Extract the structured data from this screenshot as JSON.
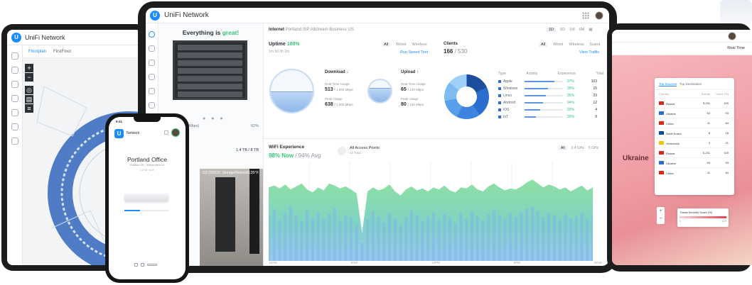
{
  "main": {
    "brand": "UniFi Network",
    "device_panel": {
      "status_prefix": "Everything is ",
      "status_word": "great!",
      "ports_label": "Ports (Fast 24 Mbps)",
      "ports_pct": "62%",
      "storage": "1.4 TB / 8 TB",
      "camera_label": "G3 2/25/20, Storage/Network",
      "camera_temp": "135°F"
    },
    "internet": {
      "label": "Internet",
      "isp": "Portland ISP Allstream Business US",
      "ranges": [
        "1D",
        "5D",
        "1M",
        "6M"
      ],
      "uptime_label": "Uptime",
      "uptime_value": "100%",
      "uptime_sub": "1m 5d 3h 2m",
      "filters": [
        "All",
        "Wired",
        "Wireless"
      ],
      "speed_test": "Run Speed Test",
      "download": {
        "title": "Download ↓",
        "realtime_label": "Real-Time Usage",
        "realtime_value": "513",
        "realtime_unit": "/ 1,000 Mbps",
        "peak_label": "Peak Usage",
        "peak_value": "638",
        "peak_unit": "/ 1,000 Mbps",
        "fill": 0.47
      },
      "upload": {
        "title": "Upload ↑",
        "realtime_label": "Real-Time Usage",
        "realtime_value": "65",
        "realtime_unit": "/ 100 Mbps",
        "peak_label": "Peak Usage",
        "peak_value": "80",
        "peak_unit": "/ 100 Mbps",
        "fill": 0.6
      }
    },
    "clients": {
      "title": "Clients",
      "count": "166",
      "total": "/ 530",
      "filters": [
        "All",
        "Wired",
        "Wireless",
        "Guest"
      ],
      "traffic_link": "View Traffic",
      "headers": [
        "Type",
        "Activity",
        "Experience",
        "Total"
      ],
      "rows": [
        {
          "name": "Apple",
          "activity": 0.78,
          "exp": "97%",
          "total": "103"
        },
        {
          "name": "Windows",
          "activity": 0.62,
          "exp": "95%",
          "total": "15"
        },
        {
          "name": "Linux",
          "activity": 0.55,
          "exp": "95%",
          "total": "23"
        },
        {
          "name": "Android",
          "activity": 0.48,
          "exp": "94%",
          "total": "12"
        },
        {
          "name": "iOS",
          "activity": 0.4,
          "exp": "92%",
          "total": "4"
        },
        {
          "name": "IoT",
          "activity": 0.3,
          "exp": "35%",
          "total": "9"
        }
      ]
    },
    "wifi": {
      "title": "WiFi Experience",
      "now_value": "98% Now",
      "avg_value": "/ 94% Avg",
      "ap_title": "All Access Points",
      "ap_sub": "12 Total",
      "bands": [
        "All",
        "2.4 GHz",
        "5 GHz"
      ],
      "x_labels": [
        "12AM",
        "6AM",
        "12PM",
        "6PM",
        "NOW"
      ]
    }
  },
  "left": {
    "brand": "UniFi Network",
    "floor": "Floorplan",
    "site": "FirstFloor"
  },
  "phone": {
    "time": "9:41",
    "net": "Network",
    "site": "Portland Office",
    "address": "Portland, OR · Independent US",
    "stats": "1.4 TB · 6 Hr",
    "progress": 0.35
  },
  "right": {
    "mode": "Real Time",
    "region": "Ukraine",
    "tabs": [
      "Top Sources",
      "Top Destination"
    ],
    "headers": [
      "Country",
      "Events",
      "Score (%)"
    ],
    "rows": [
      {
        "country": "Russia",
        "events": "5,231",
        "score": "100",
        "flag": "#d52b1e"
      },
      {
        "country": "Ukraine",
        "events": "53",
        "score": "93",
        "flag": "#2f6bd6"
      },
      {
        "country": "China",
        "events": "11",
        "score": "84",
        "flag": "#de2910"
      },
      {
        "country": "North Korea",
        "events": "6",
        "score": "18",
        "flag": "#024fa2"
      },
      {
        "country": "Venezuela",
        "events": "3",
        "score": "21",
        "flag": "#f4c300"
      },
      {
        "country": "Russia",
        "events": "5,231",
        "score": "100",
        "flag": "#d52b1e"
      },
      {
        "country": "Ukraine",
        "events": "53",
        "score": "93",
        "flag": "#2f6bd6"
      },
      {
        "country": "China",
        "events": "11",
        "score": "84",
        "flag": "#de2910"
      }
    ],
    "legend_title": "Threat Severity Score (%)",
    "legend_min": "0",
    "legend_max": "100"
  },
  "colors": {
    "accent": "#1a8cff",
    "success": "#36c27a",
    "danger": "#e2434f"
  },
  "wifi_series": {
    "top": [
      0.74,
      0.76,
      0.73,
      0.77,
      0.72,
      0.75,
      0.78,
      0.72,
      0.69,
      0.74,
      0.71,
      0.78,
      0.76,
      0.73,
      0.75,
      0.72,
      0.68,
      0.28,
      0.7,
      0.74,
      0.71,
      0.73,
      0.77,
      0.7,
      0.66,
      0.72,
      0.75,
      0.71,
      0.73,
      0.7,
      0.74,
      0.72,
      0.76,
      0.71,
      0.69,
      0.74,
      0.73,
      0.77,
      0.72,
      0.7,
      0.75,
      0.78,
      0.74,
      0.71,
      0.73,
      0.72,
      0.75,
      0.79,
      0.82,
      0.78,
      0.74,
      0.77,
      0.75,
      0.72,
      0.74,
      0.7,
      0.73,
      0.76,
      0.71,
      0.74
    ],
    "mid": [
      0.45,
      0.52,
      0.41,
      0.48,
      0.55,
      0.46,
      0.4,
      0.51,
      0.44,
      0.49,
      0.42,
      0.47,
      0.53,
      0.4,
      0.46,
      0.44,
      0.37,
      0.18,
      0.42,
      0.5,
      0.45,
      0.39,
      0.48,
      0.43,
      0.36,
      0.44,
      0.51,
      0.46,
      0.4,
      0.45,
      0.49,
      0.41,
      0.47,
      0.44,
      0.38,
      0.48,
      0.42,
      0.5,
      0.45,
      0.41,
      0.47,
      0.52,
      0.46,
      0.43,
      0.48,
      0.44,
      0.49,
      0.53,
      0.55,
      0.5,
      0.44,
      0.48,
      0.46,
      0.42,
      0.47,
      0.43,
      0.45,
      0.49,
      0.42,
      0.46
    ]
  }
}
